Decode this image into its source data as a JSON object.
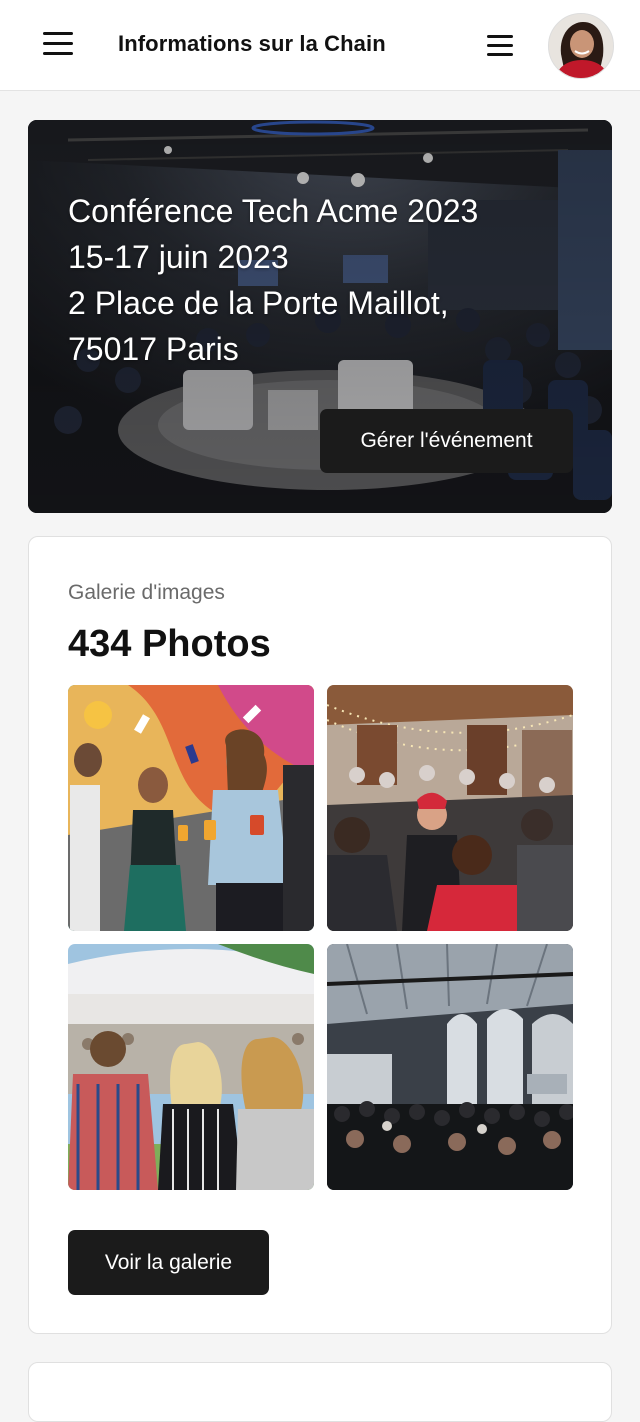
{
  "header": {
    "title": "Informations sur la Chain",
    "menu_icon": "menu-icon",
    "secondary_menu_icon": "menu-icon",
    "avatar": "user-avatar"
  },
  "hero": {
    "event_name": "Conférence Tech Acme 2023",
    "dates": "15-17 juin 2023",
    "address_line1": "2 Place de la Porte Maillot,",
    "address_line2": "75017 Paris",
    "manage_button_label": "Gérer l'événement"
  },
  "gallery": {
    "label": "Galerie d'images",
    "count_text": "434 Photos",
    "images": [
      "mural-party-photo",
      "bar-crowd-photo",
      "festival-crowd-photo",
      "hall-event-photo"
    ],
    "view_button_label": "Voir la galerie"
  },
  "colors": {
    "button_bg": "#1b1b1b",
    "page_bg": "#f5f5f5",
    "card_bg": "#ffffff"
  }
}
